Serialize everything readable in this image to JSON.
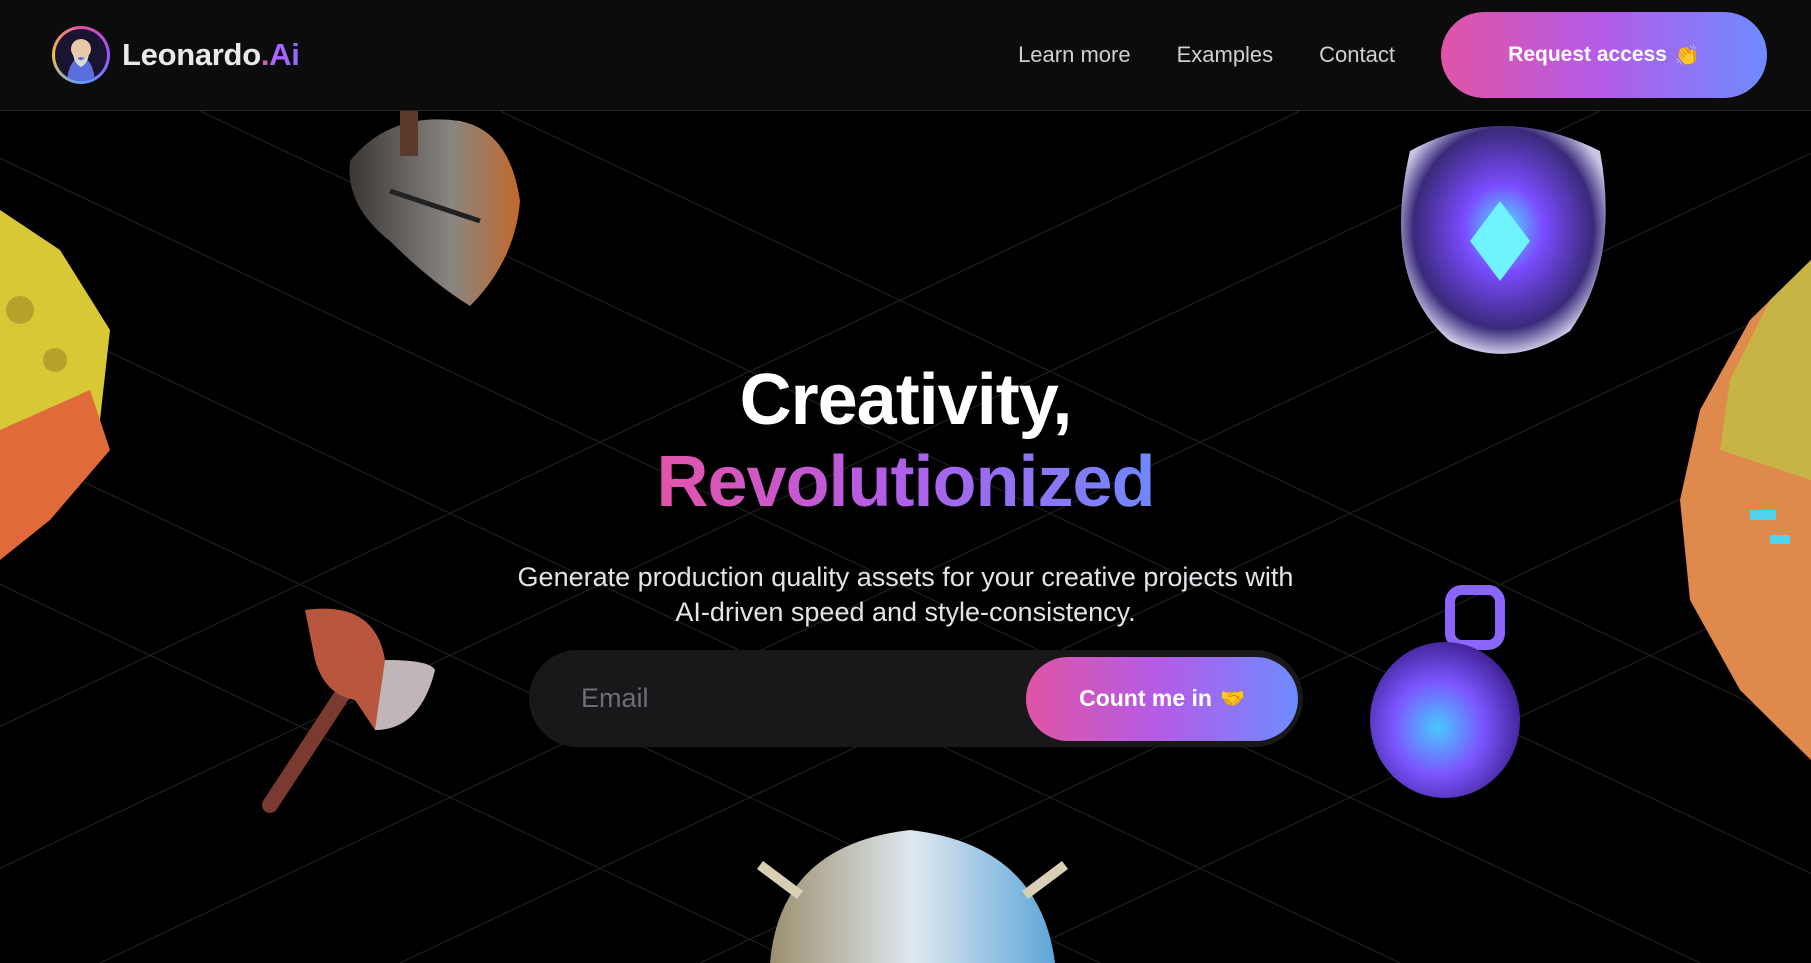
{
  "brand": {
    "name": "Leonardo",
    "dot": ".",
    "suffix": "Ai"
  },
  "nav": {
    "links": [
      {
        "label": "Learn more"
      },
      {
        "label": "Examples"
      },
      {
        "label": "Contact"
      }
    ],
    "cta_label": "Request access",
    "cta_emoji": "👏"
  },
  "hero": {
    "title_line1": "Creativity,",
    "title_line2": "Revolutionized",
    "subtitle_line1": "Generate production quality assets for your creative projects with",
    "subtitle_line2": "AI-driven speed and style-consistency."
  },
  "signup": {
    "email_placeholder": "Email",
    "button_label": "Count me in",
    "button_emoji": "🤝"
  },
  "decorations": [
    {
      "icon": "knight-helmet-icon"
    },
    {
      "icon": "crystal-shield-icon"
    },
    {
      "icon": "floating-island-icon"
    },
    {
      "icon": "rock-cliff-icon"
    },
    {
      "icon": "battle-axe-icon"
    },
    {
      "icon": "potion-grenade-icon"
    },
    {
      "icon": "ornate-helmet-icon"
    }
  ],
  "colors": {
    "accent_pink": "#e054a6",
    "accent_purple": "#b35ce8",
    "accent_blue": "#6e8bff",
    "header_bg": "#0c0c0d",
    "page_bg": "#000000"
  }
}
